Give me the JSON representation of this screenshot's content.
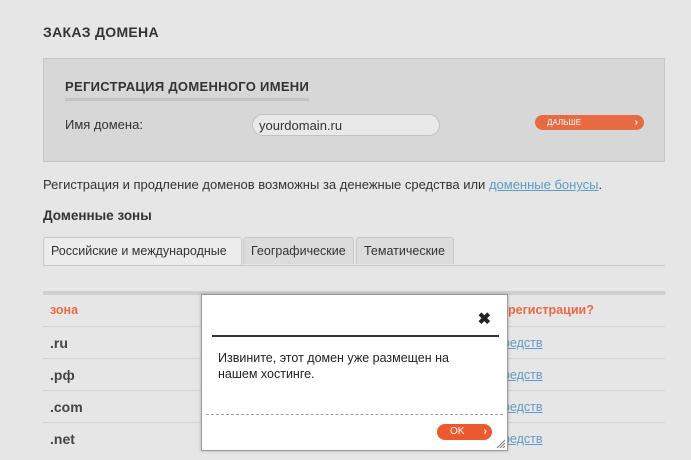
{
  "page": {
    "title": "ЗАКАЗ ДОМЕНА"
  },
  "registration": {
    "title": "РЕГИСТРАЦИЯ ДОМЕННОГО ИМЕНИ",
    "domain_label": "Имя домена:",
    "domain_value": "yourdomain.ru",
    "next_button": "ДАЛЬШЕ"
  },
  "info": {
    "text": "Регистрация и продление доменов возможны за денежные средства или ",
    "link": "доменные бонусы",
    "suffix": "."
  },
  "zones": {
    "title": "Доменные зоны",
    "tabs": [
      {
        "label": "Российские и международные",
        "active": true
      },
      {
        "label": "Географические",
        "active": false
      },
      {
        "label": "Тематические",
        "active": false
      }
    ],
    "columns": {
      "zone": "зона",
      "registration": "регистрации?"
    },
    "rows": [
      {
        "zone": ".ru",
        "link": "редств"
      },
      {
        "zone": ".рф",
        "link": "редств"
      },
      {
        "zone": ".com",
        "link": "редств"
      },
      {
        "zone": ".net",
        "link": "редств"
      }
    ]
  },
  "modal": {
    "close_icon": "close-icon",
    "message": "Извините, этот домен уже размещен на нашем хостинге.",
    "ok_button": "OK"
  },
  "colors": {
    "accent": "#e86a43",
    "link": "#5d9cc7",
    "background": "#e6e6e6",
    "panel": "#d7d7d7"
  }
}
